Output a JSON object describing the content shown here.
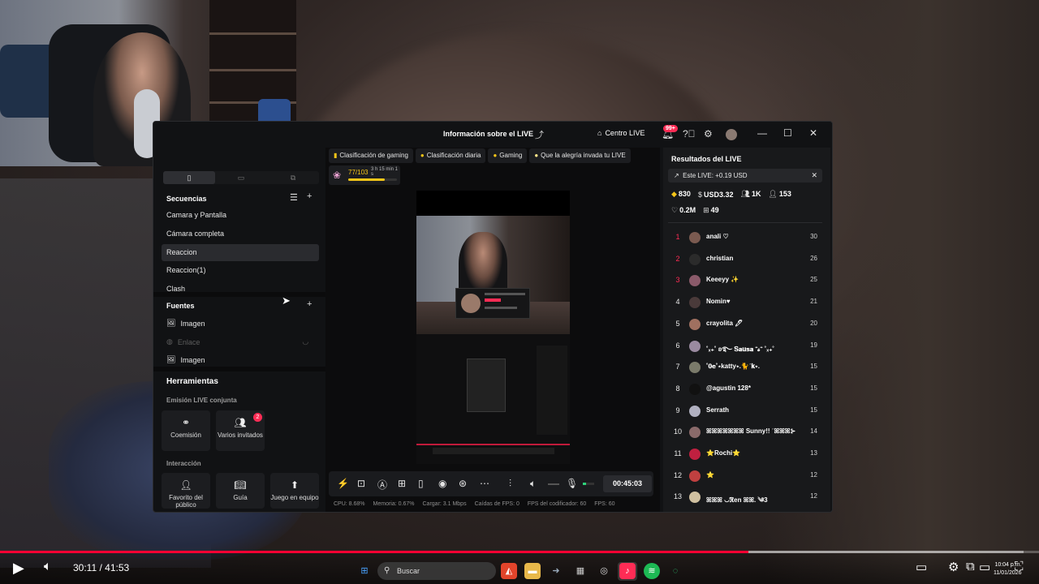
{
  "studio": {
    "title": "Información sobre el LIVE",
    "centro_live": "Centro LIVE",
    "notif_badge": "99+"
  },
  "left": {
    "sequences_heading": "Secuencias",
    "sequences": [
      "Camara y Pantalla",
      "Cámara completa",
      "Reaccion",
      "Reaccion(1)",
      "Clash"
    ],
    "sources_heading": "Fuentes",
    "sources": [
      "Imagen",
      "Enlace",
      "Imagen"
    ],
    "tools_heading": "Herramientas",
    "joint_heading": "Emisión LIVE conjunta",
    "cohost_label": "Coemisión",
    "multi_guest_label": "Varios invitados",
    "multi_guest_badge": "2",
    "interaction_heading": "Interacción",
    "fav_label": "Favorito del público",
    "guide_label": "Guía",
    "game_label": "Juego en equipo"
  },
  "center": {
    "chips": [
      "Clasificación de gaming",
      "Clasificación diaria",
      "Gaming",
      "Que la alegría invada tu LIVE"
    ],
    "gift_progress": "77/103",
    "gift_fraction": 0.75,
    "gift_time": "3 h 15 min 1 s",
    "timer": "00:45:03",
    "stats": {
      "cpu": "CPU: 8.68%",
      "memory": "Memoria: 0.67%",
      "upload": "Cargar: 3.1 Mbps",
      "fps_drop": "Caídas de FPS: 0",
      "encoder_fps": "FPS del codificador: 60",
      "fps": "FPS: 60"
    }
  },
  "right": {
    "title": "Resultados del LIVE",
    "this_live": "Este LIVE: +0.19 USD",
    "diamonds": "830",
    "usd": "USD3.32",
    "viewers": "1K",
    "followers": "153",
    "likes": "0.2M",
    "gifts": "49",
    "ranking": [
      {
        "rank": "1",
        "name": "anali ♡",
        "score": "30",
        "color": "#7a5a50"
      },
      {
        "rank": "2",
        "name": "christian",
        "score": "26",
        "color": "#2b2b2b"
      },
      {
        "rank": "3",
        "name": "Keeeyy ✨",
        "score": "25",
        "color": "#8a5a6a"
      },
      {
        "rank": "4",
        "name": "Nomin♥",
        "score": "21",
        "color": "#4a3a3a"
      },
      {
        "rank": "5",
        "name": "crayolita 🖊",
        "score": "20",
        "color": "#a07060"
      },
      {
        "rank": "6",
        "name": "˚ₓ₊˚ ʚ࿐ 𝐒𝐚𝐮𝐬𝐚 ⁺𝓼⁺ ˚ₓ₊˚",
        "score": "19",
        "color": "#9a8aa0"
      },
      {
        "rank": "7",
        "name": "˚𝟎𝐞˚⋆katty⋆.🐈ʾ𝐤⋆.",
        "score": "15",
        "color": "#7a7a6a"
      },
      {
        "rank": "8",
        "name": "@agustin 128*",
        "score": "15",
        "color": "#111111"
      },
      {
        "rank": "9",
        "name": "Serrath",
        "score": "15",
        "color": "#b0b0c0"
      },
      {
        "rank": "10",
        "name": "ꕤꕤꕤꕤꕤꕤꕤ Sunny!! ʾꕤꕤꕤ⊱",
        "score": "14",
        "color": "#8a6a6a"
      },
      {
        "rank": "11",
        "name": "⭐Rochi⭐",
        "score": "13",
        "color": "#c02040"
      },
      {
        "rank": "12",
        "name": "⭐",
        "score": "12",
        "color": "#c04040"
      },
      {
        "rank": "13",
        "name": "ꕤꕤꕤ ◡ℜen ꕤꕤ. ༄3",
        "score": "12",
        "color": "#d0c0a0"
      }
    ]
  },
  "player": {
    "time": "30:11 / 41:53",
    "progress_fraction": 0.72,
    "buffer_fraction": 0.985
  },
  "taskbar": {
    "search": "Buscar",
    "time": "10:04 p.m.",
    "date": "11/01/2026"
  },
  "icons": {
    "play": "play-icon",
    "volume": "volume-icon",
    "settings": "gear-icon",
    "close": "close-icon"
  },
  "colors": {
    "accent": "#fe2c55",
    "gold": "#f5c518",
    "youtube_red": "#ff0033"
  }
}
